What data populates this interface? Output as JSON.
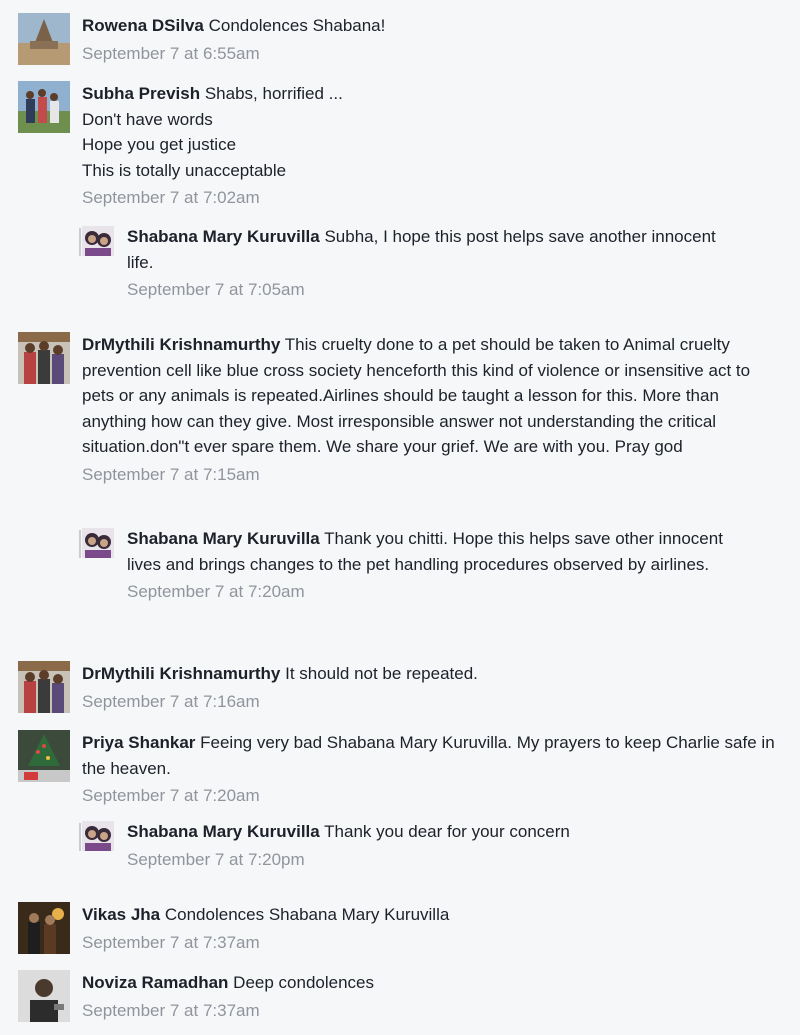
{
  "comments": [
    {
      "author": "Rowena DSilva",
      "text": "Condolences Shabana!",
      "time": "September 7 at 6:55am",
      "avatar_icon": "temple-photo-avatar"
    },
    {
      "author": "Subha Prevish",
      "text": "Shabs, horrified ...\nDon't have words\nHope you get justice\nThis is totally unacceptable",
      "time": "September 7 at 7:02am",
      "avatar_icon": "family-photo-avatar",
      "replies": [
        {
          "author": "Shabana Mary Kuruvilla",
          "text": "Subha, I hope this post helps save another innocent life.",
          "time": "September 7 at 7:05am",
          "avatar_icon": "couple-photo-avatar"
        }
      ]
    },
    {
      "author": "DrMythili Krishnamurthy",
      "text": "This cruelty done to a pet should be taken to Animal cruelty prevention cell like blue cross society henceforth this kind of violence or insensitive act to pets or any animals is repeated.Airlines should be taught a lesson for this. More than anything how can they give. Most irresponsible answer not understanding the critical situation.don\"t ever spare them. We share your grief. We are with you. Pray god",
      "time": "September 7 at 7:15am",
      "avatar_icon": "group-photo-avatar",
      "replies": [
        {
          "author": "Shabana Mary Kuruvilla",
          "text": "Thank you chitti. Hope this helps save other innocent lives and brings changes to the pet handling procedures observed by airlines.",
          "time": "September 7 at 7:20am",
          "avatar_icon": "couple-photo-avatar"
        }
      ]
    },
    {
      "author": "DrMythili Krishnamurthy",
      "text": "It should not be repeated.",
      "time": "September 7 at 7:16am",
      "avatar_icon": "group-photo-avatar"
    },
    {
      "author": "Priya Shankar",
      "text": "Feeing very bad Shabana Mary Kuruvilla. My prayers to keep Charlie safe in the heaven.",
      "time": "September 7 at 7:20am",
      "avatar_icon": "christmas-tree-avatar",
      "replies": [
        {
          "author": "Shabana Mary Kuruvilla",
          "text": "Thank you dear for your concern",
          "time": "September 7 at 7:20pm",
          "avatar_icon": "couple-photo-avatar"
        }
      ]
    },
    {
      "author": "Vikas Jha",
      "text": "Condolences Shabana Mary Kuruvilla",
      "time": "September 7 at 7:37am",
      "avatar_icon": "night-photo-avatar"
    },
    {
      "author": "Noviza Ramadhan",
      "text": "Deep condolences",
      "time": "September 7 at 7:37am",
      "avatar_icon": "person-photo-avatar"
    }
  ]
}
